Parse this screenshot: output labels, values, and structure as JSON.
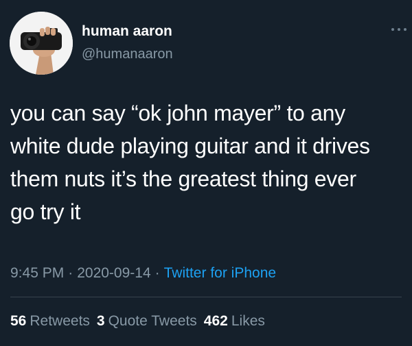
{
  "user": {
    "display_name": "human aaron",
    "handle": "@humanaaron"
  },
  "tweet": {
    "lines": [
      "you can say “ok john mayer” to any",
      "white dude playing guitar and it drives",
      "them nuts it’s the greatest thing ever",
      "go try it"
    ]
  },
  "meta": {
    "time": "9:45 PM",
    "date": "2020-09-14",
    "separator": "·",
    "source": "Twitter for iPhone"
  },
  "stats": {
    "retweets_count": "56",
    "retweets_label": "Retweets",
    "quotes_count": "3",
    "quotes_label": "Quote Tweets",
    "likes_count": "462",
    "likes_label": "Likes"
  },
  "icons": {
    "avatar": "avatar-camera-photo",
    "more": "more-options-icon"
  },
  "colors": {
    "background": "#15202b",
    "text": "#ffffff",
    "secondary_text": "#8899a6",
    "link": "#1da1f2",
    "divider": "#38444d"
  }
}
